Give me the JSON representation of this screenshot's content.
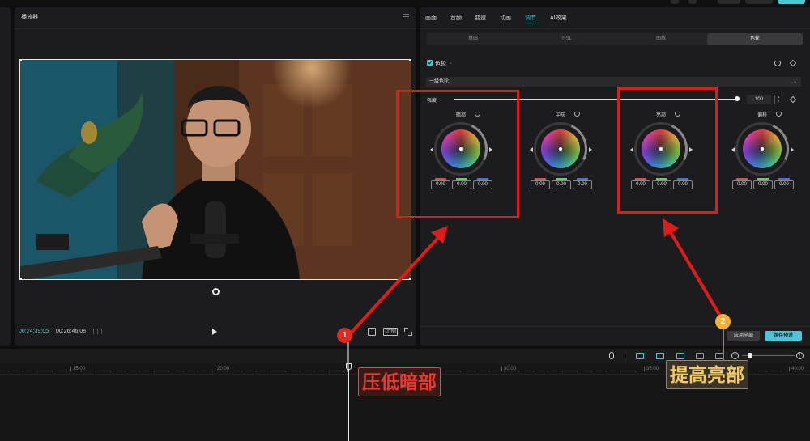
{
  "player": {
    "title": "播放器",
    "timecode_current": "00:24:39:05",
    "timecode_total": "00:26:46:08",
    "ratio_label": "比例"
  },
  "adjust": {
    "tabs": [
      "画面",
      "音频",
      "变速",
      "动画",
      "调节",
      "AI效果"
    ],
    "active_tab": "调节",
    "subtabs": [
      "基础",
      "HSL",
      "曲线",
      "色轮"
    ],
    "active_subtab": "色轮",
    "section_title": "色轮",
    "dropdown_value": "一级色轮",
    "strength_label": "强度",
    "strength_value": "100",
    "strength_level": 1.0,
    "wheels": [
      {
        "label": "暗部",
        "values": [
          "0.00",
          "0.00",
          "0.00"
        ]
      },
      {
        "label": "中灰",
        "values": [
          "0.00",
          "0.00",
          "0.00"
        ]
      },
      {
        "label": "亮部",
        "values": [
          "0.00",
          "0.00",
          "0.00"
        ]
      },
      {
        "label": "偏移",
        "values": [
          "0.00",
          "0.00",
          "0.00"
        ]
      }
    ],
    "apply_all": "应用全部",
    "save_preset": "保存预设"
  },
  "timeline": {
    "ruler_ticks": [
      "15:00",
      "20:00",
      "30:00",
      "35:00",
      "40:00"
    ]
  },
  "annotations": {
    "badge_1": "1",
    "badge_2": "2",
    "callout_1": "压低暗部",
    "callout_2": "提高亮部"
  },
  "colors": {
    "accent": "#4bc6d8",
    "annotation_red": "#e01b1b",
    "annotation_yellow": "#f2b23a",
    "wheel_bar_red": "#e04a4a",
    "wheel_bar_green": "#5ed65e",
    "wheel_bar_blue": "#4a6ee0"
  }
}
